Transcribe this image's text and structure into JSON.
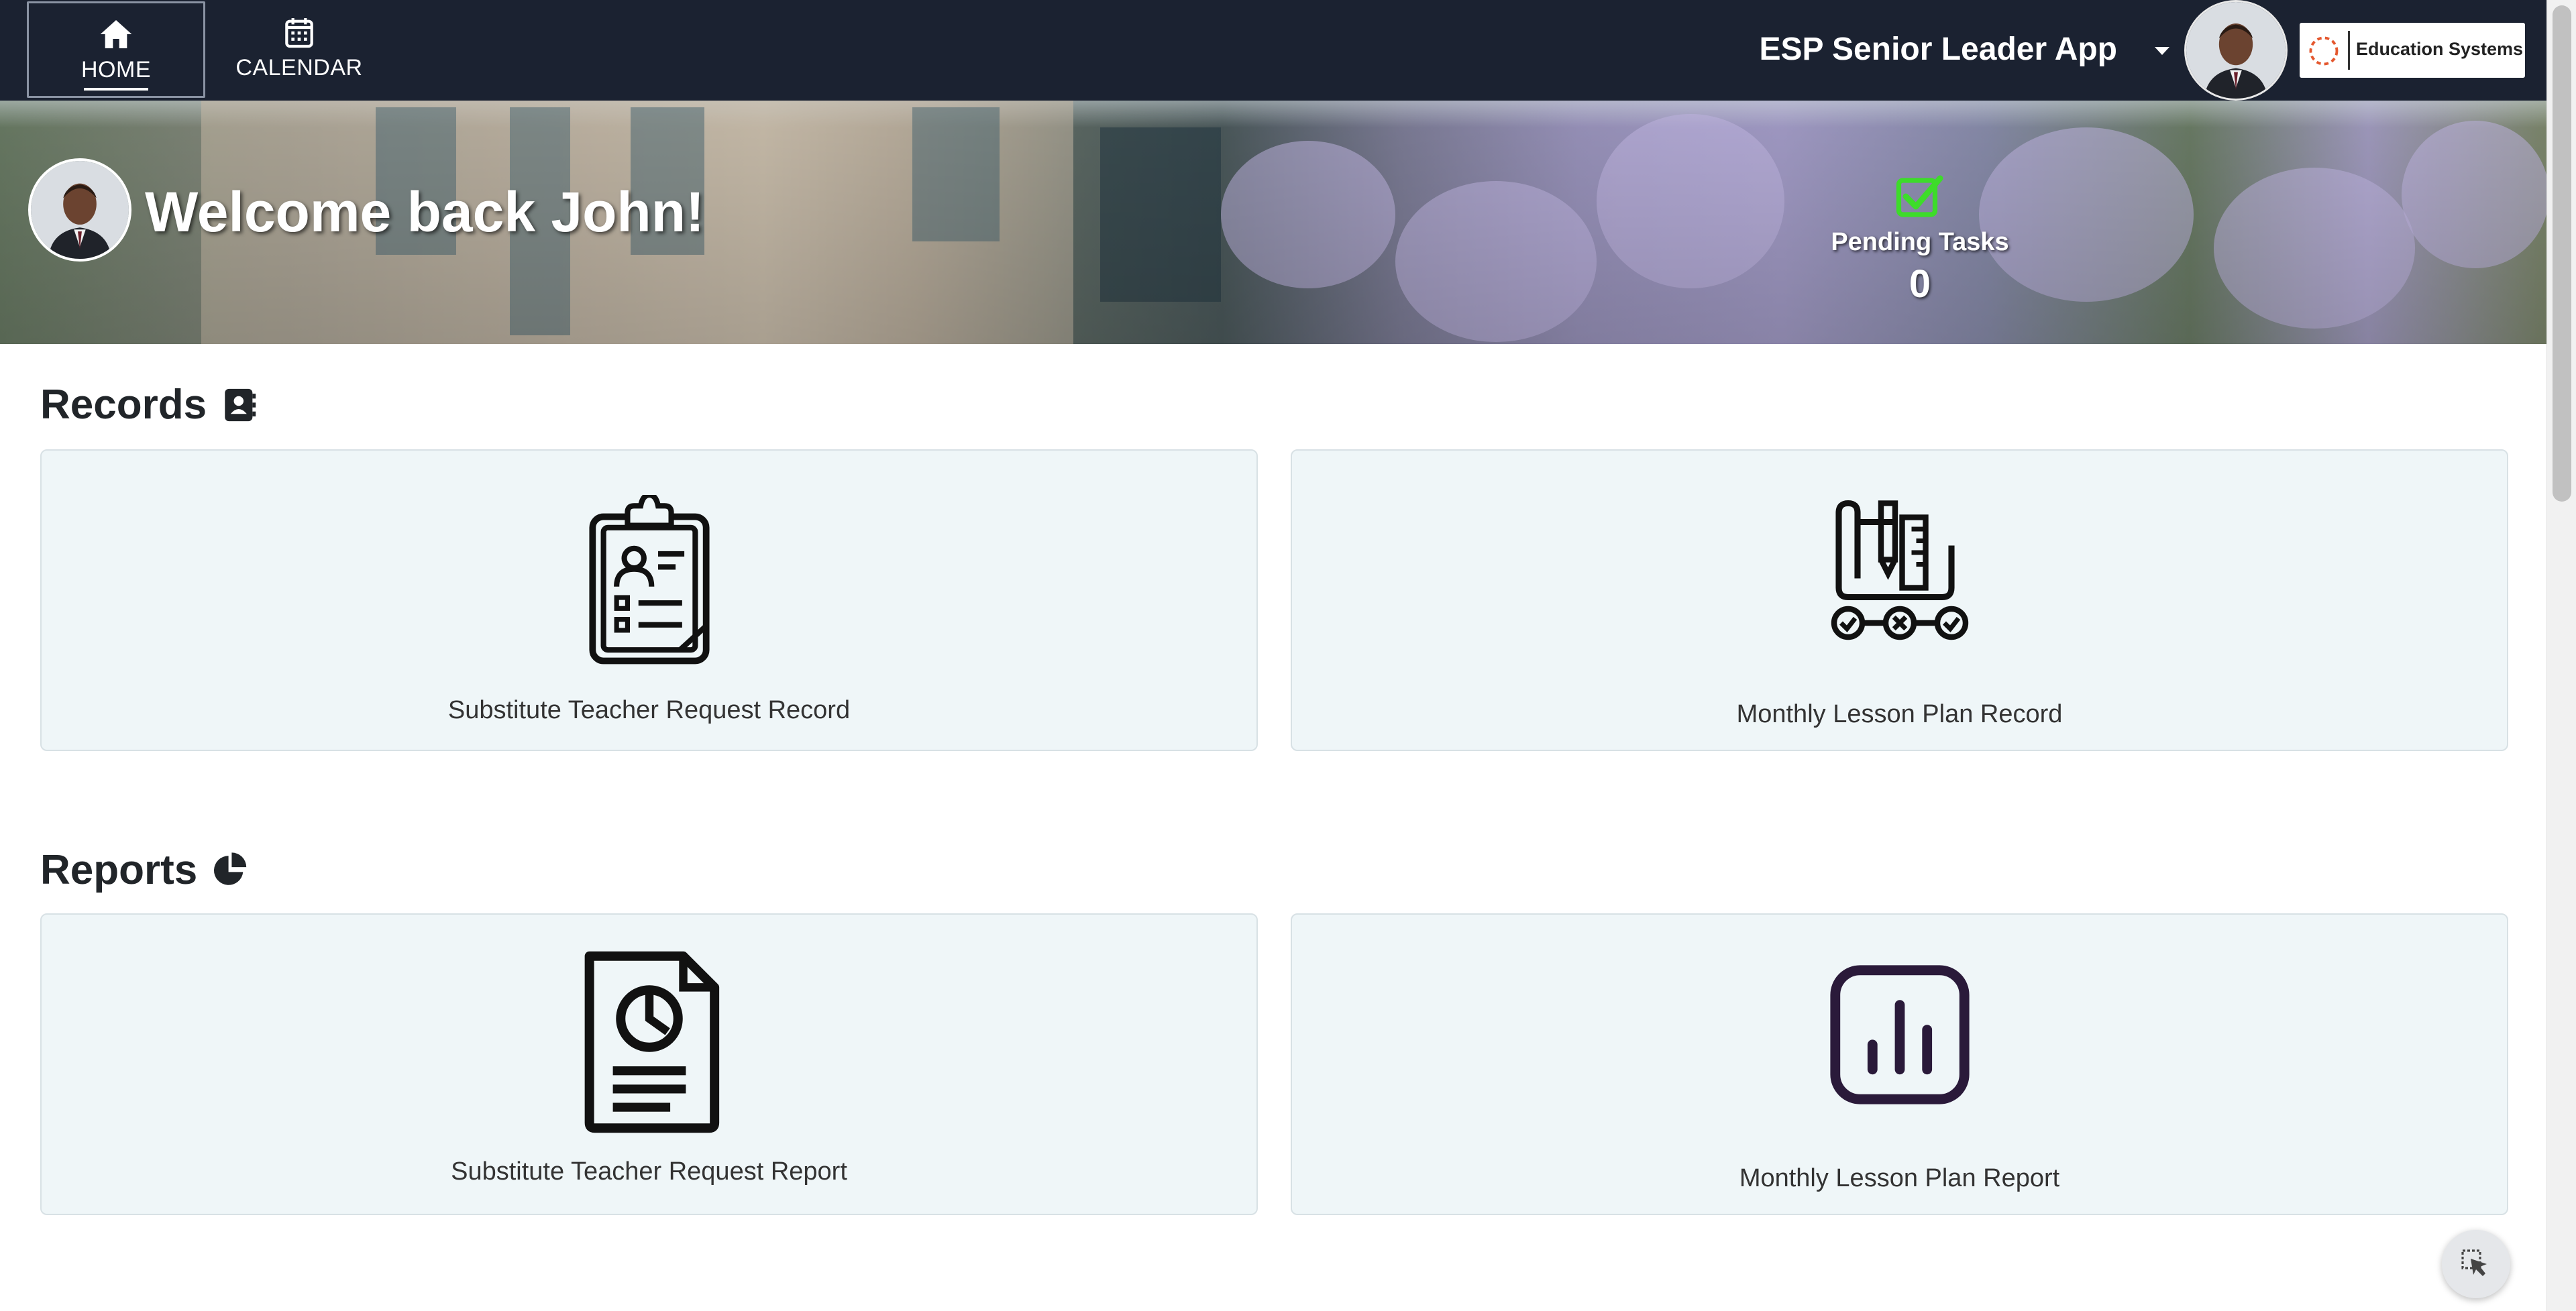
{
  "nav": {
    "tabs": [
      {
        "label": "HOME",
        "icon": "home-icon",
        "active": true
      },
      {
        "label": "CALENDAR",
        "icon": "calendar-icon",
        "active": false
      }
    ],
    "app_name": "ESP Senior Leader App",
    "brand_text": "Education Systems"
  },
  "hero": {
    "welcome": "Welcome back John!",
    "pending_label": "Pending Tasks",
    "pending_count": "0"
  },
  "records": {
    "title": "Records",
    "icon": "address-book-icon",
    "cards": [
      {
        "label": "Substitute Teacher Request Record",
        "icon": "clipboard-person-icon"
      },
      {
        "label": "Monthly Lesson Plan Record",
        "icon": "lesson-plan-tools-icon"
      }
    ]
  },
  "reports": {
    "title": "Reports",
    "icon": "pie-chart-icon",
    "cards": [
      {
        "label": "Substitute Teacher Request Report",
        "icon": "document-chart-icon"
      },
      {
        "label": "Monthly Lesson Plan Report",
        "icon": "bar-chart-square-icon"
      }
    ]
  },
  "colors": {
    "navbar": "#1b2231",
    "card_bg": "#eff6f8",
    "check_green": "#3ddc2a",
    "report_purple": "#2a1a3a"
  }
}
